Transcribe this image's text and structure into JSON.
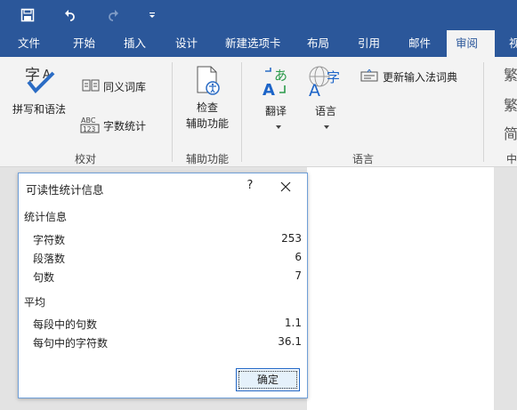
{
  "qat": {
    "icons": [
      "save-icon",
      "undo-icon",
      "redo-icon",
      "customize-icon"
    ]
  },
  "tabs": [
    {
      "label": "文件"
    },
    {
      "label": "开始"
    },
    {
      "label": "插入"
    },
    {
      "label": "设计"
    },
    {
      "label": "新建选项卡"
    },
    {
      "label": "布局"
    },
    {
      "label": "引用"
    },
    {
      "label": "邮件"
    },
    {
      "label": "审阅"
    },
    {
      "label": "视"
    }
  ],
  "ribbon": {
    "spelling": "拼写和语法",
    "thesaurus": "同义词库",
    "word_count": "字数统计",
    "proofing_group": "校对",
    "check_access_1": "检查",
    "check_access_2": "辅助功能",
    "accessibility_group": "辅助功能",
    "translate": "翻译",
    "language": "语言",
    "update_ime": "更新输入法词典",
    "language_group": "语言",
    "cut_group": "中"
  },
  "dialog": {
    "title": "可读性统计信息",
    "help": "?",
    "stats_heading": "统计信息",
    "stats": [
      {
        "label": "字符数",
        "value": "253"
      },
      {
        "label": "段落数",
        "value": "6"
      },
      {
        "label": "句数",
        "value": "7"
      }
    ],
    "avg_heading": "平均",
    "averages": [
      {
        "label": "每段中的句数",
        "value": "1.1"
      },
      {
        "label": "每句中的字符数",
        "value": "36.1"
      }
    ],
    "ok": "确定"
  },
  "colors": {
    "accent": "#2b579a",
    "ribbon_bg": "#f3f3f3",
    "dialog_border": "#6f9fd8"
  }
}
